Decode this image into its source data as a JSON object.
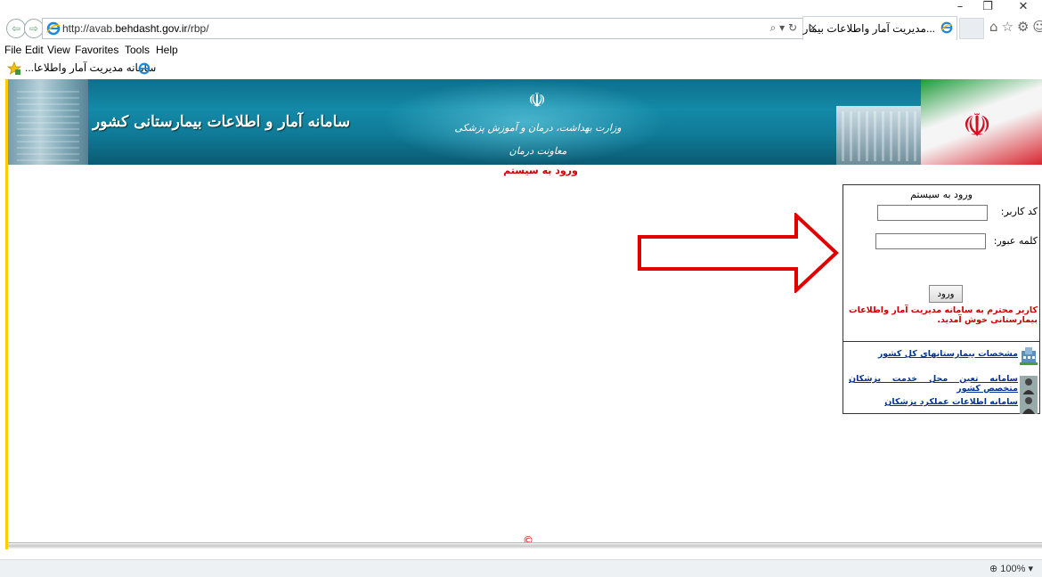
{
  "window": {
    "minimize_glyph": "–",
    "restore_glyph": "❐",
    "close_glyph": "✕"
  },
  "address_bar": {
    "url_prefix": "http://avab.",
    "url_domain": "behdasht.gov.ir",
    "url_suffix": "/rbp/",
    "search_glyph": "⌕",
    "dropdown_glyph": "▾",
    "refresh_glyph": "↻"
  },
  "tab": {
    "title": "...مدیریت آمار واطلاعات بیمار",
    "close_glyph": "×"
  },
  "toolbar_icons": "⌂☆⚙☺",
  "menu": {
    "file": "File",
    "edit": "Edit",
    "view": "View",
    "favorites": "Favorites",
    "tools": "Tools",
    "help": "Help"
  },
  "favorites_bar": {
    "item": "...سامانه مدیریت آمار واطلاعا"
  },
  "banner": {
    "site_title": "سامانه آمار و اطلاعات بیمارستانی کشور",
    "ministry": "وزارت بهداشت، درمان و آموزش پزشکی",
    "deputy": "معاونت درمان"
  },
  "page": {
    "login_heading": "ورود به سیستم",
    "copyright": "©"
  },
  "login_panel": {
    "title": "ورود به سیستم",
    "user_code_label": "کد کاربر:",
    "password_label": "کلمه عبور:",
    "submit_label": "ورود",
    "welcome_text": "کاربر محترم به سامانه مدیریت آمار واطلاعات بیمارستانی خوش آمدید."
  },
  "links": [
    {
      "label": "مشخصات بیمارستانهای کل کشور"
    },
    {
      "label": "سامانه تعین محل خدمت پزشکان متخصص کشور"
    },
    {
      "label": "سامانه اطلاعات عملکرد پزشکان"
    }
  ],
  "status_bar": {
    "zoom": "100%",
    "zoom_glyph": "⊕",
    "zoom_dropdown": "▾"
  },
  "colors": {
    "accent_red": "#cc0000",
    "link_blue": "#003399",
    "banner_teal": "#138aa8",
    "viewport_border": "#ffcc00"
  }
}
